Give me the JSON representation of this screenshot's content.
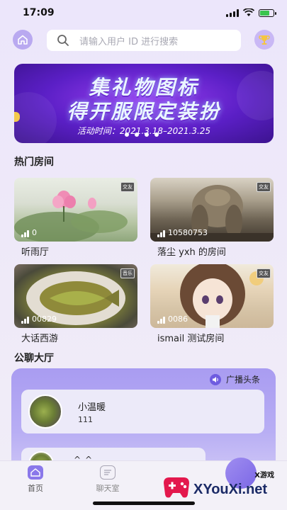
{
  "status_bar": {
    "time": "17:09"
  },
  "header": {
    "search_placeholder": "请输入用户 ID 进行搜索",
    "home_icon": "home-icon",
    "trophy_icon": "trophy-icon"
  },
  "banner": {
    "line1": "集礼物图标",
    "line2": "得开服限定装扮",
    "date": "活动时间：2021.3.18–2021.3.25",
    "dot_count": 4
  },
  "hot_rooms": {
    "title": "热门房间",
    "badge_label": "交友",
    "items": [
      {
        "name": "听雨厅",
        "count": "0",
        "badge": "交友"
      },
      {
        "name": "落尘 yxh 的房间",
        "count": "10580753",
        "badge": "交友"
      },
      {
        "name": "大话西游",
        "count": "00829",
        "badge": "音乐"
      },
      {
        "name": "ismail 测试房间",
        "count": "0086",
        "badge": "交友"
      }
    ]
  },
  "public_hall": {
    "title": "公聊大厅",
    "broadcast_label": "广播头条",
    "messages": [
      {
        "name": "小温暖",
        "text": "111"
      },
      {
        "name": "",
        "text": "^_^"
      }
    ]
  },
  "bottom_nav": {
    "items": [
      {
        "label": "首页",
        "active": true
      },
      {
        "label": "聊天室",
        "active": false
      }
    ]
  },
  "watermark": {
    "text": "XYouXi.net",
    "small": "X游戏"
  },
  "colors": {
    "accent": "#7c68e6",
    "banner_bg": "#5b1fc6",
    "hall_bg": "#a99cf1"
  }
}
